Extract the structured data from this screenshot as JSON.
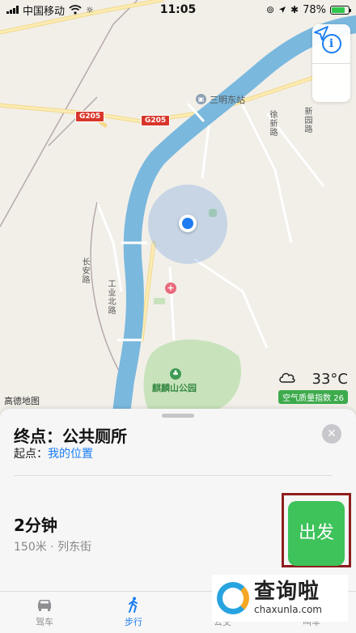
{
  "status_bar": {
    "carrier": "中国移动",
    "time": "11:05",
    "battery": "78%",
    "battery_level": 0.78,
    "icons": [
      "signal-icon",
      "wifi-icon",
      "brightness-icon",
      "orientation-lock-icon",
      "location-arrow-icon",
      "bluetooth-icon",
      "battery-icon"
    ]
  },
  "map": {
    "road_signs": [
      "G205",
      "G205"
    ],
    "labels": {
      "station": "三明东站",
      "road_a": "徐新路",
      "road_b": "新园路",
      "road_c": "长安路",
      "road_d": "工业北路",
      "park": "麒麟山公园"
    },
    "attribution": "高德地图",
    "controls": [
      "info-icon",
      "location-arrow-icon"
    ],
    "colors": {
      "river": "#7ab8de",
      "park": "#c8e3bb",
      "road": "#f7e6a6",
      "user_dot": "#1e7cf2"
    }
  },
  "weather": {
    "temperature": "33°C",
    "aqi_label": "空气质量指数 26",
    "icon": "cloud-icon"
  },
  "route_card": {
    "destination_label": "终点：公共厕所",
    "origin_prefix": "起点：",
    "origin_value": "我的位置",
    "duration": "2分钟",
    "detail": "150米 · 列东街",
    "go_label": "出发",
    "go_color": "#3ec25a",
    "accent": "#1a7cf2"
  },
  "watermark": {
    "text_cn": "查询啦",
    "text_en": "chaxunla.com"
  },
  "tabs": [
    {
      "label": "驾车",
      "icon": "car-icon",
      "active": false
    },
    {
      "label": "步行",
      "icon": "walking-icon",
      "active": true
    },
    {
      "label": "公交",
      "icon": "transit-icon",
      "active": false
    },
    {
      "label": "叫车",
      "icon": "ride-hail-icon",
      "active": false
    }
  ]
}
